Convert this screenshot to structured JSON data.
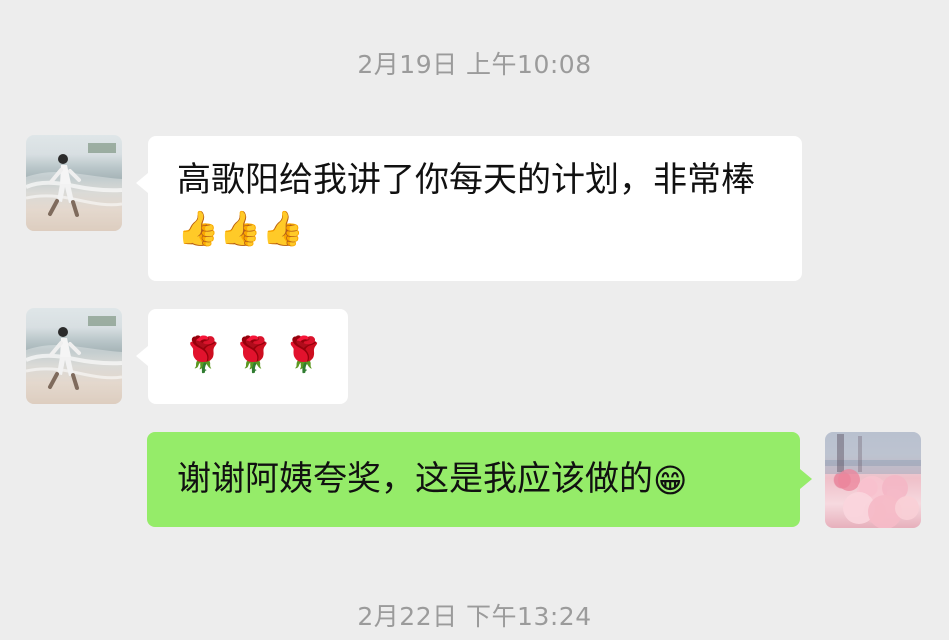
{
  "chat": {
    "timestamps": {
      "top": "2月19日 上午10:08",
      "bottom": "2月22日 下午13:24"
    },
    "messages": [
      {
        "side": "left",
        "text": "高歌阳给我讲了你每天的计划，非常棒",
        "emoji_suffix": "👍👍👍"
      },
      {
        "side": "left",
        "text": "🌹🌹🌹"
      },
      {
        "side": "right",
        "text": "谢谢阿姨夸奖，这是我应该做的",
        "emoji_suffix": "😁"
      }
    ]
  },
  "colors": {
    "background": "#ededed",
    "incoming_bubble": "#ffffff",
    "outgoing_bubble": "#95ec69",
    "timestamp": "#9b9b9b",
    "message_text": "#111111"
  },
  "icons": {
    "thumbs_up": "thumbs-up-icon",
    "rose": "rose-icon",
    "grinning_face": "grinning-face-icon"
  }
}
